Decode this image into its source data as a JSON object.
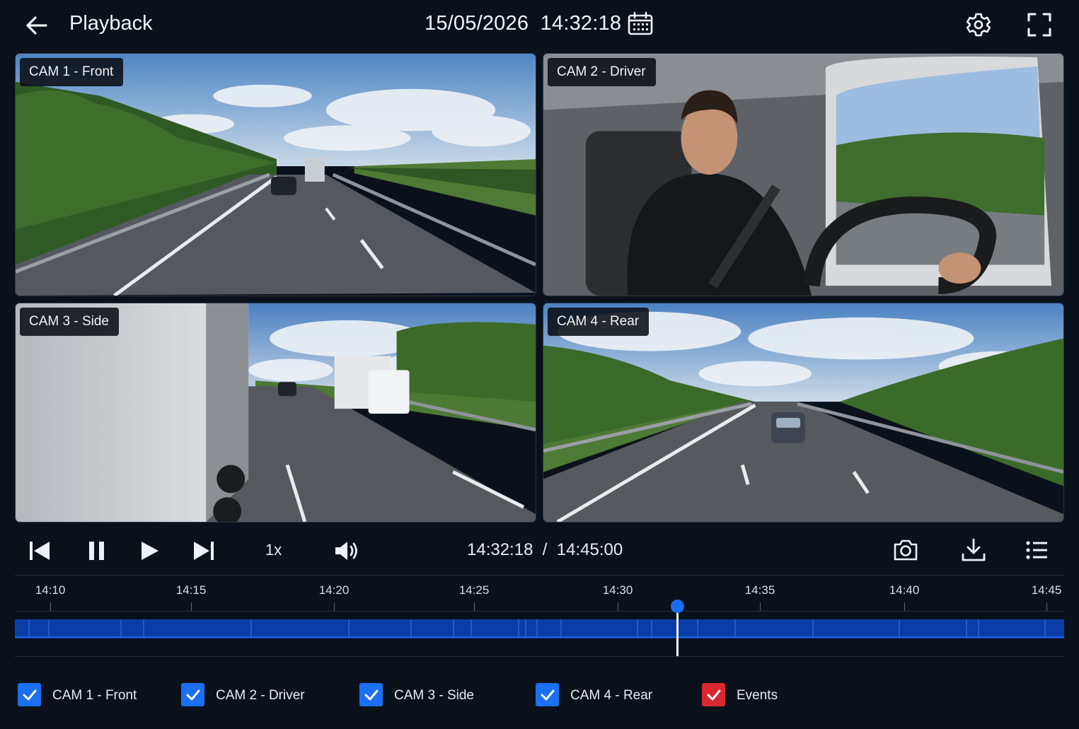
{
  "header": {
    "title": "Playback",
    "date": "15/05/2026",
    "time": "14:32:18"
  },
  "cameras": [
    {
      "label": "CAM 1 - Front"
    },
    {
      "label": "CAM 2 - Driver"
    },
    {
      "label": "CAM 3 - Side"
    },
    {
      "label": "CAM 4 - Rear"
    }
  ],
  "controls": {
    "speed": "1x",
    "current_time": "14:32:18",
    "separator": "/",
    "total_time": "14:45:00"
  },
  "timeline": {
    "ticks": [
      "14:10",
      "14:15",
      "14:20",
      "14:25",
      "14:30",
      "14:35",
      "14:40",
      "14:45"
    ],
    "track_color": "#0a3ea6",
    "playhead_color": "#1c6cf0"
  },
  "toggles": [
    {
      "label": "CAM 1 - Front",
      "checked": true,
      "color": "#1a6ff2"
    },
    {
      "label": "CAM 2 - Driver",
      "checked": true,
      "color": "#1a6ff2"
    },
    {
      "label": "CAM 3 - Side",
      "checked": true,
      "color": "#1a6ff2"
    },
    {
      "label": "CAM 4 - Rear",
      "checked": true,
      "color": "#1a6ff2"
    },
    {
      "label": "Events",
      "checked": true,
      "color": "#d9282f"
    }
  ]
}
